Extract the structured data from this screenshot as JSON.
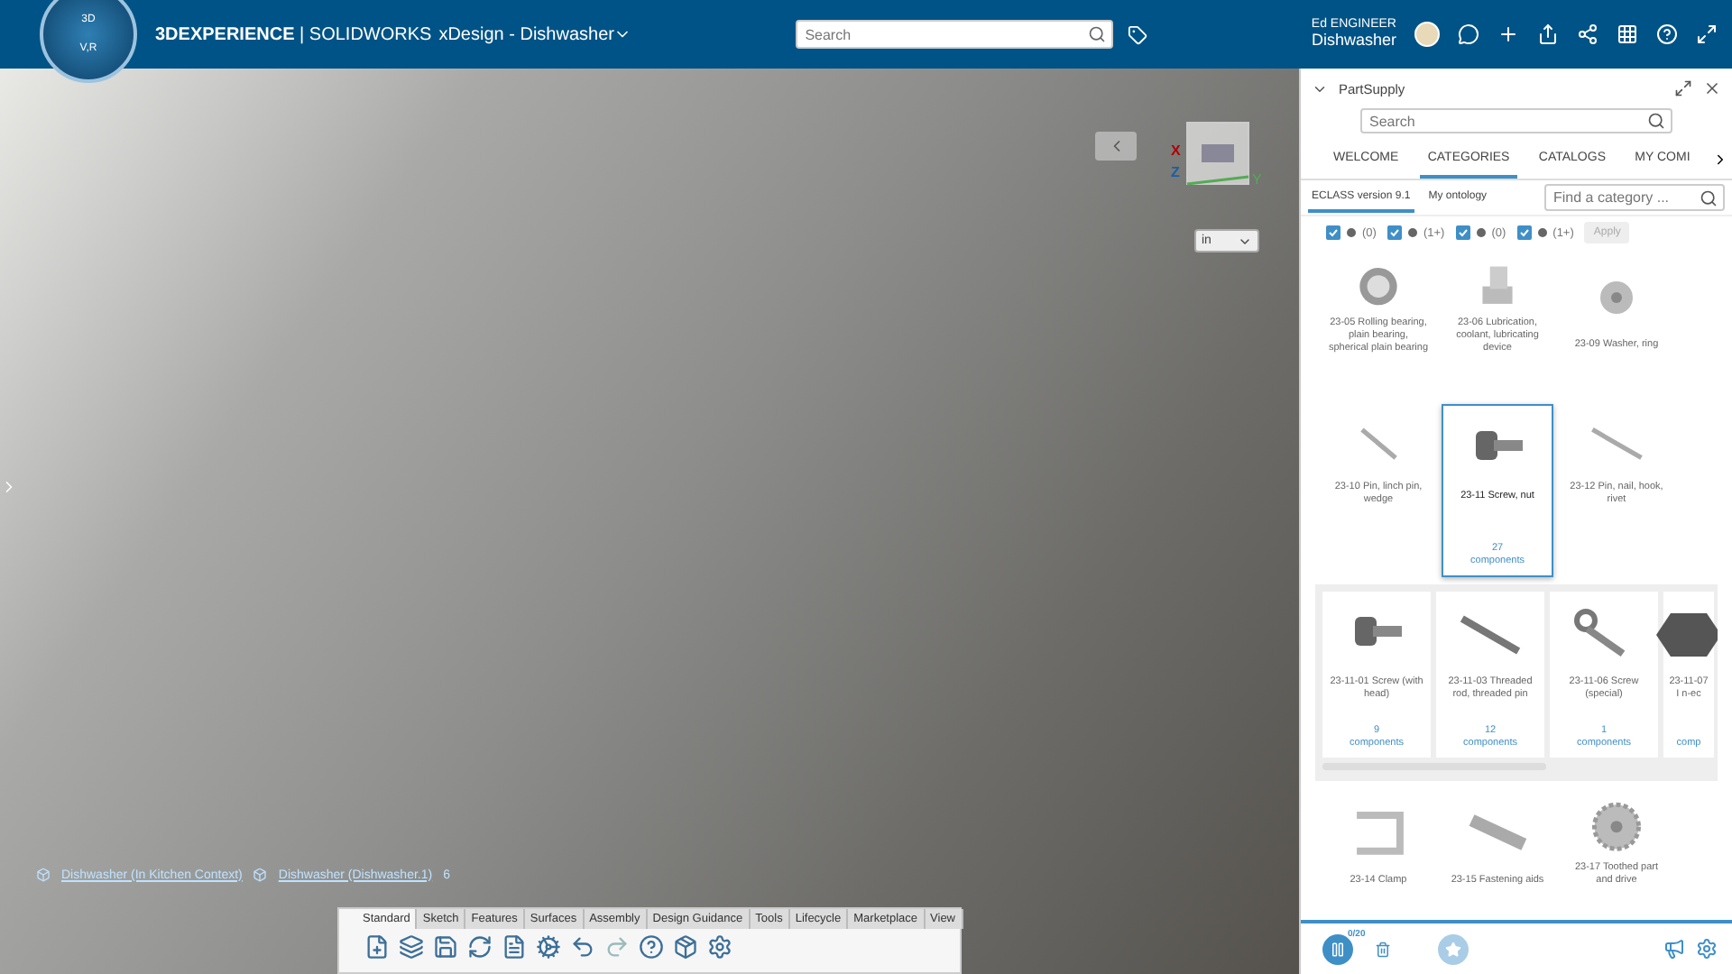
{
  "topbar": {
    "compass": {
      "top": "3D",
      "bottom": "V,R"
    },
    "brand_bold": "3DEXPERIENCE",
    "brand_rest": " | SOLIDWORKS",
    "app_title": "xDesign - Dishwasher",
    "search": {
      "placeholder": "Search"
    },
    "user": {
      "name": "Ed ENGINEER",
      "context": "Dishwasher"
    }
  },
  "viewport": {
    "view_cube": {
      "axes": [
        "X",
        "Y",
        "Z"
      ]
    },
    "unit_select": {
      "value": "in"
    },
    "breadcrumbs": [
      {
        "label": "Dishwasher (In Kitchen Context)"
      },
      {
        "label": "Dishwasher (Dishwasher.1)"
      }
    ],
    "badge": "6"
  },
  "command_bar": {
    "tabs": [
      {
        "label": "Standard",
        "selected": true
      },
      {
        "label": "Sketch",
        "selected": false
      },
      {
        "label": "Features",
        "selected": false
      },
      {
        "label": "Surfaces",
        "selected": false
      },
      {
        "label": "Assembly",
        "selected": false
      },
      {
        "label": "Design Guidance",
        "selected": false
      },
      {
        "label": "Tools",
        "selected": false
      },
      {
        "label": "Lifecycle",
        "selected": false
      },
      {
        "label": "Marketplace",
        "selected": false
      },
      {
        "label": "View",
        "selected": false
      }
    ]
  },
  "panel": {
    "title": "PartSupply",
    "search": {
      "placeholder": "Search"
    },
    "tabs": [
      {
        "label": "WELCOME",
        "selected": false
      },
      {
        "label": "CATEGORIES",
        "selected": true
      },
      {
        "label": "CATALOGS",
        "selected": false
      },
      {
        "label": "MY COMI",
        "selected": false
      }
    ],
    "subtabs": [
      {
        "label": "ECLASS version 9.1",
        "selected": true
      },
      {
        "label": "My ontology",
        "selected": false
      }
    ],
    "category_search": {
      "placeholder": "Find a category ..."
    },
    "filters": [
      {
        "count": "(0)",
        "checked": true
      },
      {
        "count": "(1+)",
        "checked": true
      },
      {
        "count": "(0)",
        "checked": true
      },
      {
        "count": "(1+)",
        "checked": true
      }
    ],
    "apply_button": {
      "label": "Apply",
      "disabled": true
    },
    "categories": [
      {
        "kind": "bearing",
        "label": "23-05 Rolling bearing, plain bearing, spherical plain bearing",
        "selected": false
      },
      {
        "kind": "fitting",
        "label": "23-06 Lubrication, coolant, lubricating device",
        "selected": false
      },
      {
        "kind": "washer",
        "label": "23-09 Washer, ring",
        "selected": false
      },
      {
        "kind": "pin",
        "label": "23-10 Pin, linch pin, wedge",
        "selected": false
      },
      {
        "kind": "screw",
        "label": "23-11 Screw, nut",
        "selected": true,
        "count": "27",
        "count_unit": "components"
      },
      {
        "kind": "nail",
        "label": "23-12 Pin, nail, hook, rivet",
        "selected": false
      }
    ],
    "subcategories": [
      {
        "kind": "screw",
        "label": "23-11-01 Screw (with head)",
        "count": "9",
        "count_unit": "components"
      },
      {
        "kind": "rod",
        "label": "23-11-03 Threaded rod, threaded pin",
        "count": "12",
        "count_unit": "components"
      },
      {
        "kind": "eyebolt",
        "label": "23-11-06 Screw (special)",
        "count": "1",
        "count_unit": "components"
      },
      {
        "kind": "nut",
        "label": "23-11-07 I n-ec",
        "count_unit": "comp"
      }
    ],
    "more_categories": [
      {
        "kind": "clamp",
        "label": "23-14 Clamp"
      },
      {
        "kind": "fastener",
        "label": "23-15 Fastening aids"
      },
      {
        "kind": "gear",
        "label": "23-17 Toothed part and drive"
      }
    ],
    "basket_count": "0/20"
  }
}
